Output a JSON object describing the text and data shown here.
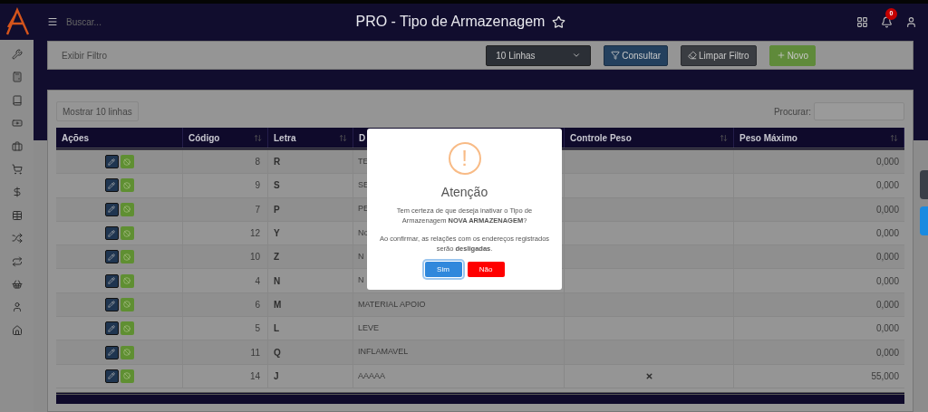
{
  "header": {
    "search_placeholder": "Buscar...",
    "title": "PRO - Tipo de Armazenagem",
    "notification_count": "0"
  },
  "filter": {
    "label": "Exibir Filtro",
    "select_value": "10 Linhas",
    "buttons": [
      {
        "kind": "consult",
        "label": "Consultar"
      },
      {
        "kind": "clear",
        "label": "Limpar Filtro"
      },
      {
        "kind": "new",
        "label": "Novo"
      }
    ]
  },
  "table": {
    "length_button": "Mostrar 10 linhas",
    "search_label": "Procurar:",
    "columns": [
      {
        "label": "Ações",
        "sortable": false
      },
      {
        "label": "Código",
        "sortable": true
      },
      {
        "label": "Letra",
        "sortable": true
      },
      {
        "label": "D"
      },
      {
        "label": "Controle Peso",
        "sortable": true
      },
      {
        "label": "Peso Máximo",
        "sortable": true
      }
    ],
    "rows": [
      {
        "codigo": "8",
        "letra": "R",
        "descricao": "TE",
        "controle_peso": false,
        "peso_maximo": "0,000"
      },
      {
        "codigo": "9",
        "letra": "S",
        "descricao": "SE",
        "controle_peso": false,
        "peso_maximo": "0,000"
      },
      {
        "codigo": "7",
        "letra": "P",
        "descricao": "PE",
        "controle_peso": false,
        "peso_maximo": "0,000"
      },
      {
        "codigo": "12",
        "letra": "Y",
        "descricao": "No",
        "controle_peso": false,
        "peso_maximo": "0,000"
      },
      {
        "codigo": "10",
        "letra": "Z",
        "descricao": "N",
        "controle_peso": false,
        "peso_maximo": "0,000"
      },
      {
        "codigo": "4",
        "letra": "N",
        "descricao": "N",
        "controle_peso": false,
        "peso_maximo": "0,000"
      },
      {
        "codigo": "6",
        "letra": "M",
        "descricao": "MATERIAL APOIO",
        "controle_peso": false,
        "peso_maximo": "0,000"
      },
      {
        "codigo": "5",
        "letra": "L",
        "descricao": "LEVE",
        "controle_peso": false,
        "peso_maximo": "0,000"
      },
      {
        "codigo": "11",
        "letra": "Q",
        "descricao": "INFLAMAVEL",
        "controle_peso": false,
        "peso_maximo": "0,000"
      },
      {
        "codigo": "14",
        "letra": "J",
        "descricao": "AAAAA",
        "controle_peso": true,
        "peso_maximo": "55,000"
      }
    ]
  },
  "modal": {
    "symbol": "!",
    "title": "Atenção",
    "paragraphs": [
      "Tem certeza de que deseja inativar o Tipo de Armazenagem **NOVA ARMAZENAGEM**?",
      "Ao confirmar, as relações com os endereços registrados serão **desligadas**."
    ],
    "buttons": [
      {
        "kind": "confirm",
        "label": "Sim"
      },
      {
        "kind": "cancel",
        "label": "Não"
      }
    ]
  }
}
